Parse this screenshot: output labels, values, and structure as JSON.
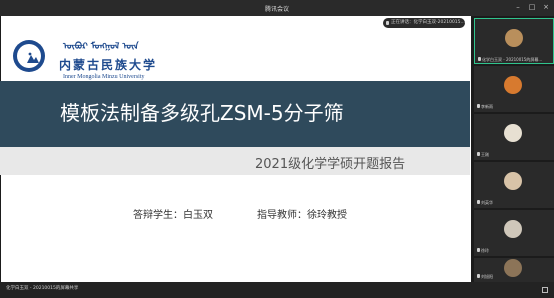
{
  "window": {
    "title": "腾讯会议"
  },
  "speaking": {
    "text": "正在讲话：化学白玉双-20210015..."
  },
  "slide": {
    "university_mongol": "ᠥᠪᠥᠷ ᠮᠣᠩᠭᠣᠯ ᠦᠨ",
    "university_cn": "内蒙古民族大学",
    "university_en": "Inner Mongolia Minzu University",
    "title": "模板法制备多级孔ZSM-5分子筛",
    "subtitle": "2021级化学学硕开题报告",
    "student": "答辩学生：白玉双",
    "advisor": "指导教师：徐玲教授",
    "colors": {
      "band": "#2f4a5c",
      "logo": "#1e4a8e"
    }
  },
  "participants": [
    {
      "label": "化学白玉双 - 20210015的屏幕...",
      "avatar_color": "#b98f5c",
      "active": true,
      "icon": "avatar-icon"
    },
    {
      "label": "李新雨",
      "avatar_color": "#d77a2f",
      "active": false,
      "icon": "avatar-icon"
    },
    {
      "label": "王刚",
      "avatar_color": "#e7e0d2",
      "active": false,
      "icon": "avatar-icon"
    },
    {
      "label": "刘英华",
      "avatar_color": "#d8c3a8",
      "active": false,
      "icon": "avatar-icon"
    },
    {
      "label": "徐玲",
      "avatar_color": "#cfc7ba",
      "active": false,
      "icon": "avatar-icon"
    },
    {
      "label": "刘旭阳",
      "avatar_color": "#8c7458",
      "active": false,
      "icon": "avatar-icon"
    }
  ],
  "bottom": {
    "label": "化学白玉双 - 20210015的屏幕共享"
  }
}
